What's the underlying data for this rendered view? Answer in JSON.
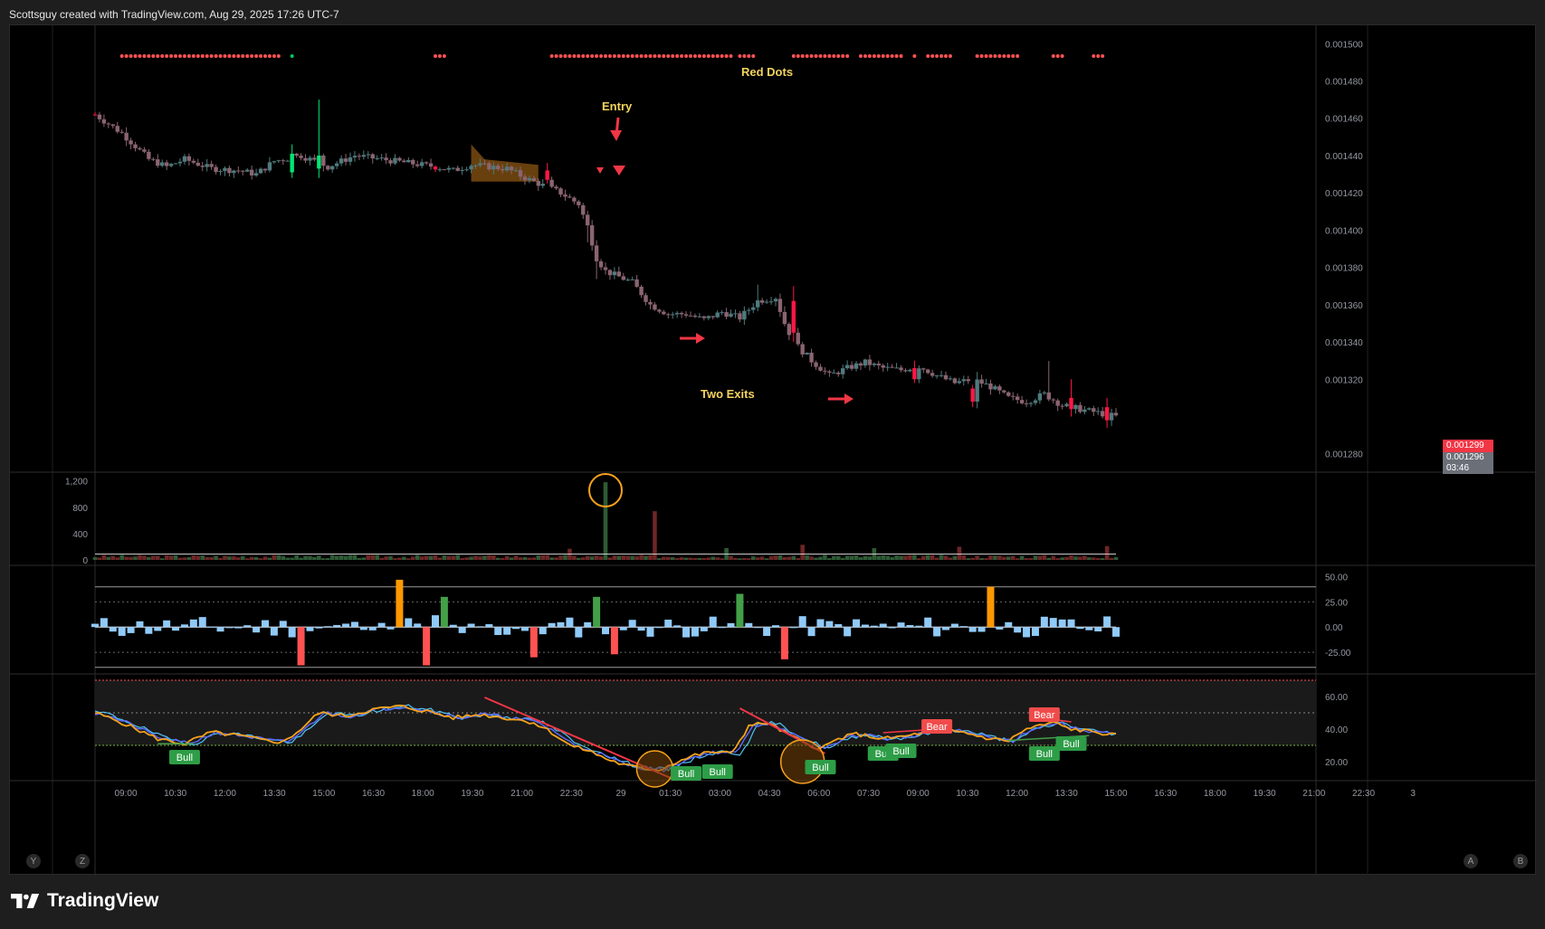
{
  "header": {
    "caption": "Scottsguy created with TradingView.com, Aug 29, 2025 17:26 UTC-7"
  },
  "footer": {
    "brand": "TradingView"
  },
  "corner_buttons": {
    "y": "Y",
    "z": "Z",
    "a": "A",
    "b": "B"
  },
  "annotations": {
    "entry": "Entry",
    "red_dots": "Red Dots",
    "two_exits": "Two Exits"
  },
  "price_tags": {
    "last": "0.001299",
    "prev": "0.001296",
    "countdown": "03:46"
  },
  "colors": {
    "up_bright": "#00e676",
    "down_bright": "#ff1744",
    "up_muted": "#4f7a7d",
    "down_muted": "#8a6470",
    "dot": "#ff5252",
    "dot_green": "#00c853",
    "volume_down": "#6e2626",
    "volume_up": "#2d5a35",
    "hist_blue": "#90caf9",
    "hist_orange": "#ff9800",
    "hist_green": "#43a047",
    "hist_red": "#ff5252",
    "stoch_k": "#f7a21b",
    "stoch_d": "#5b6bff",
    "annotation_text": "#f4d35e",
    "arrow_red": "#f23645"
  },
  "chart_data": [
    {
      "type": "candlestick",
      "title": "",
      "y_axis": {
        "ticks": [
          "0.001500",
          "0.001480",
          "0.001460",
          "0.001440",
          "0.001420",
          "0.001400",
          "0.001380",
          "0.001360",
          "0.001340",
          "0.001320",
          "0.001280"
        ],
        "range": [
          0.001275,
          0.001505
        ]
      },
      "x_axis": {
        "ticks": [
          "09:00",
          "10:30",
          "12:00",
          "13:30",
          "15:00",
          "16:30",
          "18:00",
          "19:30",
          "21:00",
          "22:30",
          "29",
          "01:30",
          "03:00",
          "04:30",
          "06:00",
          "07:30",
          "09:00",
          "10:30",
          "12:00",
          "13:30",
          "15:00",
          "16:30",
          "18:00",
          "19:30",
          "21:00",
          "22:30",
          "3"
        ]
      },
      "path_anchors": [
        [
          0,
          0.001462
        ],
        [
          6,
          0.001452
        ],
        [
          12,
          0.001438
        ],
        [
          16,
          0.001434
        ],
        [
          20,
          0.001438
        ],
        [
          26,
          0.001433
        ],
        [
          32,
          0.001432
        ],
        [
          36,
          0.00143
        ],
        [
          40,
          0.001437
        ],
        [
          46,
          0.00144
        ],
        [
          52,
          0.001434
        ],
        [
          58,
          0.00144
        ],
        [
          64,
          0.001438
        ],
        [
          70,
          0.001436
        ],
        [
          76,
          0.001434
        ],
        [
          80,
          0.001432
        ],
        [
          84,
          0.001435
        ],
        [
          92,
          0.001433
        ],
        [
          96,
          0.001428
        ],
        [
          100,
          0.001424
        ],
        [
          104,
          0.00142
        ],
        [
          108,
          0.001414
        ],
        [
          110,
          0.001402
        ],
        [
          112,
          0.001385
        ],
        [
          114,
          0.001378
        ],
        [
          120,
          0.001372
        ],
        [
          124,
          0.00136
        ],
        [
          128,
          0.001355
        ],
        [
          132,
          0.001355
        ],
        [
          136,
          0.001352
        ],
        [
          140,
          0.001356
        ],
        [
          144,
          0.001353
        ],
        [
          148,
          0.001362
        ],
        [
          152,
          0.001364
        ],
        [
          154,
          0.00135
        ],
        [
          156,
          0.00134
        ],
        [
          160,
          0.00133
        ],
        [
          164,
          0.001322
        ],
        [
          168,
          0.001326
        ],
        [
          172,
          0.001329
        ],
        [
          176,
          0.001326
        ],
        [
          180,
          0.001325
        ],
        [
          184,
          0.001327
        ],
        [
          188,
          0.001322
        ],
        [
          192,
          0.001318
        ],
        [
          196,
          0.00132
        ],
        [
          200,
          0.001316
        ],
        [
          204,
          0.00131
        ],
        [
          208,
          0.001308
        ],
        [
          212,
          0.001312
        ],
        [
          216,
          0.001306
        ],
        [
          220,
          0.001304
        ],
        [
          224,
          0.001302
        ],
        [
          228,
          0.0013
        ]
      ],
      "candle_count": 229,
      "big_candles": [
        {
          "index": 44,
          "direction": "up",
          "open": 0.001431,
          "close": 0.001441,
          "high": 0.001446,
          "low": 0.001428
        },
        {
          "index": 50,
          "direction": "up",
          "open": 0.001433,
          "close": 0.00144,
          "high": 0.00147,
          "low": 0.001428
        },
        {
          "index": 101,
          "direction": "down",
          "open": 0.001432,
          "close": 0.001427,
          "high": 0.001436,
          "low": 0.001425
        },
        {
          "index": 156,
          "direction": "down",
          "open": 0.001362,
          "close": 0.001345,
          "high": 0.00137,
          "low": 0.00134
        },
        {
          "index": 183,
          "direction": "down",
          "open": 0.001326,
          "close": 0.00132,
          "high": 0.00133,
          "low": 0.001318
        },
        {
          "index": 196,
          "direction": "down",
          "open": 0.001315,
          "close": 0.001308,
          "high": 0.001317,
          "low": 0.001305
        },
        {
          "index": 218,
          "direction": "down",
          "open": 0.00131,
          "close": 0.001304,
          "high": 0.00132,
          "low": 0.0013
        },
        {
          "index": 226,
          "direction": "down",
          "open": 0.001305,
          "close": 0.001298,
          "high": 0.00131,
          "low": 0.001294
        }
      ],
      "red_dot_ranges": [
        [
          6,
          41
        ],
        [
          76,
          78
        ],
        [
          102,
          142
        ],
        [
          144,
          147
        ],
        [
          156,
          168
        ],
        [
          171,
          180
        ],
        [
          183,
          183
        ],
        [
          186,
          191
        ],
        [
          197,
          206
        ],
        [
          214,
          216
        ],
        [
          223,
          225
        ]
      ],
      "green_dots": [
        44
      ],
      "annotations": [
        {
          "text_key": "entry",
          "candle_index": 104
        },
        {
          "text_key": "red_dots",
          "candle_index": 134
        },
        {
          "text_key": "two_exits",
          "candle_index": 125
        }
      ],
      "price_labels": [
        "0.001299",
        "0.001296",
        "03:46"
      ]
    },
    {
      "type": "bar",
      "title": "",
      "y_axis": {
        "ticks": [
          "1,200",
          "800",
          "400",
          "0"
        ],
        "range": [
          0,
          1250
        ]
      },
      "spikes": [
        {
          "index": 114,
          "value": 1180
        },
        {
          "index": 125,
          "value": 740
        },
        {
          "index": 106,
          "value": 170
        },
        {
          "index": 141,
          "value": 180
        },
        {
          "index": 158,
          "value": 230
        },
        {
          "index": 174,
          "value": 180
        },
        {
          "index": 193,
          "value": 200
        },
        {
          "index": 226,
          "value": 210
        }
      ],
      "baseline_value": 60
    },
    {
      "type": "bar",
      "title": "",
      "y_axis": {
        "ticks": [
          "50.00",
          "25.00",
          "0.00",
          "-25.00"
        ],
        "range": [
          -42,
          55
        ]
      },
      "highlight_bars": [
        {
          "index": 68,
          "value": 47,
          "color": "orange"
        },
        {
          "index": 79,
          "value": 30,
          "color": "green"
        },
        {
          "index": 113,
          "value": 30,
          "color": "green"
        },
        {
          "index": 145,
          "value": 33,
          "color": "green"
        },
        {
          "index": 200,
          "value": 40,
          "color": "orange"
        },
        {
          "index": 46,
          "value": -38,
          "color": "red"
        },
        {
          "index": 75,
          "value": -38,
          "color": "red"
        },
        {
          "index": 99,
          "value": -30,
          "color": "red"
        },
        {
          "index": 116,
          "value": -27,
          "color": "red"
        },
        {
          "index": 155,
          "value": -32,
          "color": "red"
        }
      ]
    },
    {
      "type": "line",
      "title": "",
      "y_axis": {
        "ticks": [
          "60.00",
          "40.00",
          "20.00"
        ],
        "range": [
          10,
          70
        ]
      },
      "path_anchors": [
        [
          0,
          50
        ],
        [
          6,
          44
        ],
        [
          14,
          34
        ],
        [
          20,
          31
        ],
        [
          26,
          38
        ],
        [
          32,
          36
        ],
        [
          38,
          33
        ],
        [
          42,
          32
        ],
        [
          46,
          40
        ],
        [
          50,
          50
        ],
        [
          56,
          48
        ],
        [
          62,
          52
        ],
        [
          68,
          54
        ],
        [
          74,
          51
        ],
        [
          80,
          47
        ],
        [
          86,
          49
        ],
        [
          94,
          46
        ],
        [
          98,
          44
        ],
        [
          102,
          38
        ],
        [
          106,
          30
        ],
        [
          110,
          27
        ],
        [
          114,
          22
        ],
        [
          118,
          18
        ],
        [
          122,
          16
        ],
        [
          126,
          15
        ],
        [
          130,
          20
        ],
        [
          134,
          24
        ],
        [
          138,
          26
        ],
        [
          142,
          25
        ],
        [
          144,
          33
        ],
        [
          146,
          42
        ],
        [
          150,
          44
        ],
        [
          154,
          38
        ],
        [
          158,
          32
        ],
        [
          162,
          28
        ],
        [
          166,
          34
        ],
        [
          170,
          37
        ],
        [
          176,
          34
        ],
        [
          182,
          36
        ],
        [
          188,
          40
        ],
        [
          194,
          38
        ],
        [
          200,
          34
        ],
        [
          204,
          33
        ],
        [
          208,
          40
        ],
        [
          214,
          44
        ],
        [
          218,
          40
        ],
        [
          224,
          38
        ],
        [
          228,
          36
        ]
      ],
      "labels": [
        {
          "text": "Bull",
          "index": 20
        },
        {
          "text": "Bull",
          "index": 132
        },
        {
          "text": "Bull",
          "index": 139
        },
        {
          "text": "Bull",
          "index": 162
        },
        {
          "text": "Bull",
          "index": 176
        },
        {
          "text": "Bull",
          "index": 180
        },
        {
          "text": "Bear",
          "index": 188
        },
        {
          "text": "Bear",
          "index": 212
        },
        {
          "text": "Bull",
          "index": 212
        },
        {
          "text": "Bull",
          "index": 218
        }
      ]
    }
  ]
}
